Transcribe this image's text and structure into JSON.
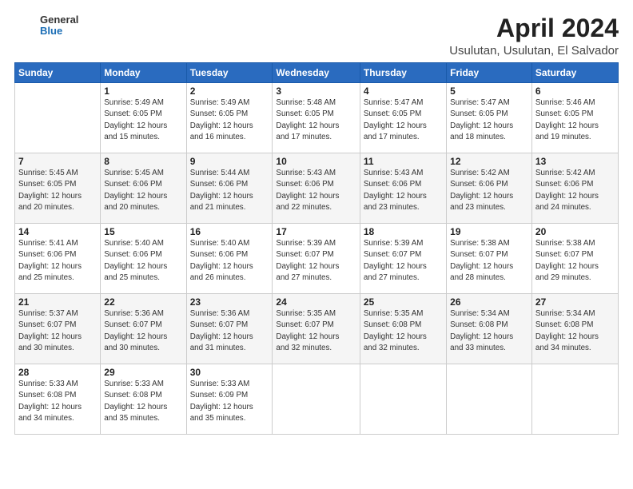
{
  "header": {
    "logo_general": "General",
    "logo_blue": "Blue",
    "month_title": "April 2024",
    "location": "Usulutan, Usulutan, El Salvador"
  },
  "calendar": {
    "days_of_week": [
      "Sunday",
      "Monday",
      "Tuesday",
      "Wednesday",
      "Thursday",
      "Friday",
      "Saturday"
    ],
    "weeks": [
      [
        {
          "day": "",
          "detail": ""
        },
        {
          "day": "1",
          "detail": "Sunrise: 5:49 AM\nSunset: 6:05 PM\nDaylight: 12 hours\nand 15 minutes."
        },
        {
          "day": "2",
          "detail": "Sunrise: 5:49 AM\nSunset: 6:05 PM\nDaylight: 12 hours\nand 16 minutes."
        },
        {
          "day": "3",
          "detail": "Sunrise: 5:48 AM\nSunset: 6:05 PM\nDaylight: 12 hours\nand 17 minutes."
        },
        {
          "day": "4",
          "detail": "Sunrise: 5:47 AM\nSunset: 6:05 PM\nDaylight: 12 hours\nand 17 minutes."
        },
        {
          "day": "5",
          "detail": "Sunrise: 5:47 AM\nSunset: 6:05 PM\nDaylight: 12 hours\nand 18 minutes."
        },
        {
          "day": "6",
          "detail": "Sunrise: 5:46 AM\nSunset: 6:05 PM\nDaylight: 12 hours\nand 19 minutes."
        }
      ],
      [
        {
          "day": "7",
          "detail": "Sunrise: 5:45 AM\nSunset: 6:05 PM\nDaylight: 12 hours\nand 20 minutes."
        },
        {
          "day": "8",
          "detail": "Sunrise: 5:45 AM\nSunset: 6:06 PM\nDaylight: 12 hours\nand 20 minutes."
        },
        {
          "day": "9",
          "detail": "Sunrise: 5:44 AM\nSunset: 6:06 PM\nDaylight: 12 hours\nand 21 minutes."
        },
        {
          "day": "10",
          "detail": "Sunrise: 5:43 AM\nSunset: 6:06 PM\nDaylight: 12 hours\nand 22 minutes."
        },
        {
          "day": "11",
          "detail": "Sunrise: 5:43 AM\nSunset: 6:06 PM\nDaylight: 12 hours\nand 23 minutes."
        },
        {
          "day": "12",
          "detail": "Sunrise: 5:42 AM\nSunset: 6:06 PM\nDaylight: 12 hours\nand 23 minutes."
        },
        {
          "day": "13",
          "detail": "Sunrise: 5:42 AM\nSunset: 6:06 PM\nDaylight: 12 hours\nand 24 minutes."
        }
      ],
      [
        {
          "day": "14",
          "detail": "Sunrise: 5:41 AM\nSunset: 6:06 PM\nDaylight: 12 hours\nand 25 minutes."
        },
        {
          "day": "15",
          "detail": "Sunrise: 5:40 AM\nSunset: 6:06 PM\nDaylight: 12 hours\nand 25 minutes."
        },
        {
          "day": "16",
          "detail": "Sunrise: 5:40 AM\nSunset: 6:06 PM\nDaylight: 12 hours\nand 26 minutes."
        },
        {
          "day": "17",
          "detail": "Sunrise: 5:39 AM\nSunset: 6:07 PM\nDaylight: 12 hours\nand 27 minutes."
        },
        {
          "day": "18",
          "detail": "Sunrise: 5:39 AM\nSunset: 6:07 PM\nDaylight: 12 hours\nand 27 minutes."
        },
        {
          "day": "19",
          "detail": "Sunrise: 5:38 AM\nSunset: 6:07 PM\nDaylight: 12 hours\nand 28 minutes."
        },
        {
          "day": "20",
          "detail": "Sunrise: 5:38 AM\nSunset: 6:07 PM\nDaylight: 12 hours\nand 29 minutes."
        }
      ],
      [
        {
          "day": "21",
          "detail": "Sunrise: 5:37 AM\nSunset: 6:07 PM\nDaylight: 12 hours\nand 30 minutes."
        },
        {
          "day": "22",
          "detail": "Sunrise: 5:36 AM\nSunset: 6:07 PM\nDaylight: 12 hours\nand 30 minutes."
        },
        {
          "day": "23",
          "detail": "Sunrise: 5:36 AM\nSunset: 6:07 PM\nDaylight: 12 hours\nand 31 minutes."
        },
        {
          "day": "24",
          "detail": "Sunrise: 5:35 AM\nSunset: 6:07 PM\nDaylight: 12 hours\nand 32 minutes."
        },
        {
          "day": "25",
          "detail": "Sunrise: 5:35 AM\nSunset: 6:08 PM\nDaylight: 12 hours\nand 32 minutes."
        },
        {
          "day": "26",
          "detail": "Sunrise: 5:34 AM\nSunset: 6:08 PM\nDaylight: 12 hours\nand 33 minutes."
        },
        {
          "day": "27",
          "detail": "Sunrise: 5:34 AM\nSunset: 6:08 PM\nDaylight: 12 hours\nand 34 minutes."
        }
      ],
      [
        {
          "day": "28",
          "detail": "Sunrise: 5:33 AM\nSunset: 6:08 PM\nDaylight: 12 hours\nand 34 minutes."
        },
        {
          "day": "29",
          "detail": "Sunrise: 5:33 AM\nSunset: 6:08 PM\nDaylight: 12 hours\nand 35 minutes."
        },
        {
          "day": "30",
          "detail": "Sunrise: 5:33 AM\nSunset: 6:09 PM\nDaylight: 12 hours\nand 35 minutes."
        },
        {
          "day": "",
          "detail": ""
        },
        {
          "day": "",
          "detail": ""
        },
        {
          "day": "",
          "detail": ""
        },
        {
          "day": "",
          "detail": ""
        }
      ]
    ]
  }
}
